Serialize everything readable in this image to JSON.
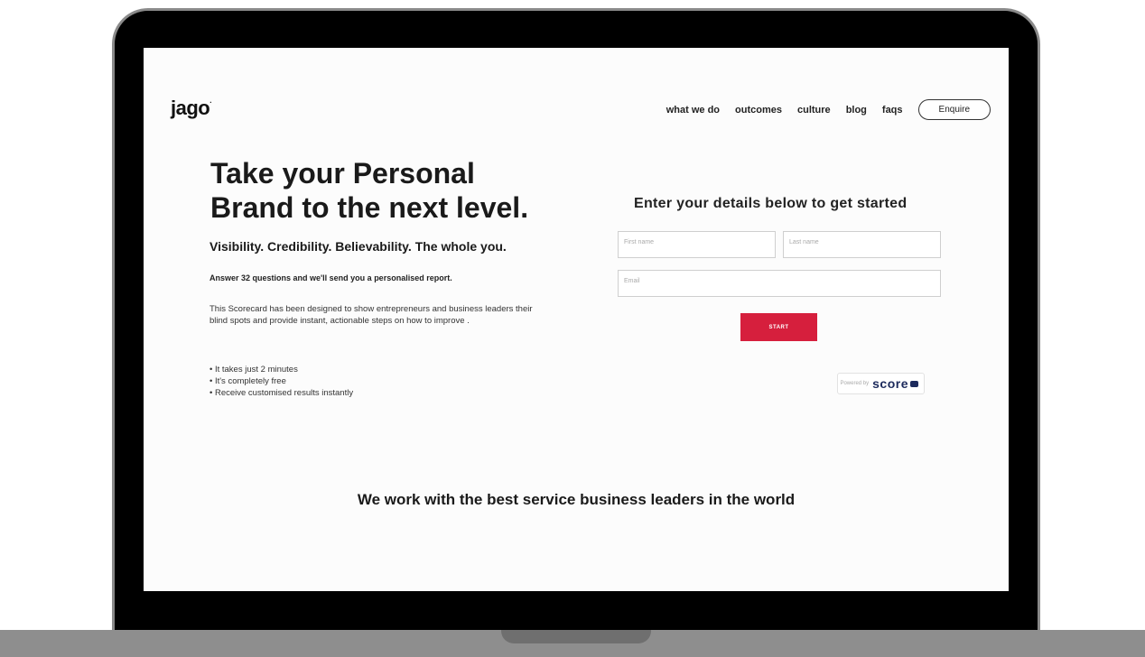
{
  "brand": {
    "name": "jago",
    "mark": "."
  },
  "nav": {
    "items": [
      {
        "label": "what we do"
      },
      {
        "label": "outcomes"
      },
      {
        "label": "culture"
      },
      {
        "label": "blog"
      },
      {
        "label": "faqs"
      }
    ],
    "cta_label": "Enquire"
  },
  "hero": {
    "title": "Take your Personal Brand to the next level.",
    "tagline": "Visibility. Credibility. Believability. The whole you.",
    "subline": "Answer 32 questions and we'll send you a personalised report.",
    "description": "This Scorecard has been designed to show entrepreneurs and business leaders their blind spots and provide instant, actionable steps on how to improve .",
    "bullets": [
      "It takes just 2 minutes",
      "It's completely free",
      "Receive customised results instantly"
    ]
  },
  "form": {
    "title": "Enter your details below to get started",
    "first_name_placeholder": "First name",
    "last_name_placeholder": "Last name",
    "email_placeholder": "Email",
    "submit_label": "START",
    "powered_by_label": "Powered by",
    "powered_by_brand": "score"
  },
  "clients": {
    "heading": "We work with the best service business leaders in the world"
  },
  "colors": {
    "accent": "#d61f3d",
    "score_brand": "#1c2a5c",
    "frame": "#000000"
  }
}
